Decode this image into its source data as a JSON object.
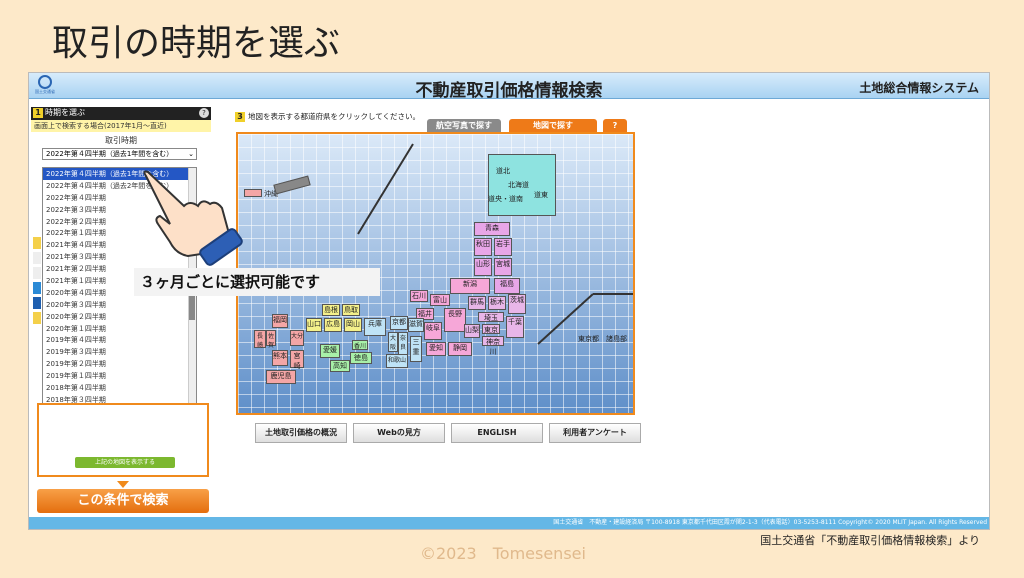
{
  "slide": {
    "title": "取引の時期を選ぶ",
    "credit": "©2023　Tomesensei",
    "source": "国土交通省「不動産取引価格情報検索」より",
    "callout": "３ヶ月ごとに選択可能です"
  },
  "app": {
    "logo_text": "国土交通省",
    "title": "不動産取引価格情報検索",
    "system_name": "土地総合情報システム",
    "footer": "国土交通省　不動産・建設経済局 〒100-8918 東京都千代田区霞が関2-1-3（代表電話）03-5253-8111 Copyright© 2020 MLIT Japan. All Rights Reserved"
  },
  "left_panel": {
    "step1_num": "1",
    "step1_title": "時期を選ぶ",
    "step1_info": "?",
    "subbar_text": "画面上で検索する場合(2017年1月～直近)",
    "period_label": "取引時期",
    "selected_value": "2022年第４四半期（過去1年間を含む）",
    "dropdown_options": [
      "2022年第４四半期（過去1年間を含む）",
      "2022年第４四半期（過去2年間を含む）",
      "2022年第４四半期",
      "2022年第３四半期",
      "2022年第２四半期",
      "2022年第１四半期",
      "2021年第４四半期",
      "2021年第３四半期",
      "2021年第２四半期",
      "2021年第１四半期",
      "2020年第４四半期",
      "2020年第３四半期",
      "2020年第２四半期",
      "2020年第１四半期",
      "2019年第４四半期",
      "2019年第３四半期",
      "2019年第２四半期",
      "2019年第１四半期",
      "2018年第４四半期",
      "2018年第３四半期"
    ],
    "show_map_button": "上記の地図を表示する",
    "search_button": "この条件で検索"
  },
  "map": {
    "step3_num": "3",
    "instruction": "地図を表示する都道府県をクリックしてください。",
    "tabs": {
      "aerial": "航空写真で探す",
      "map": "地図で探す",
      "help": "?"
    },
    "labels": {
      "okinawa": "沖縄",
      "dohoku": "道北",
      "hokkaido": "北海道",
      "doto": "道東",
      "doo_donan": "道央・道南",
      "aomori": "青森",
      "akita": "秋田",
      "iwate": "岩手",
      "yamagata": "山形",
      "miyagi": "宮城",
      "niigata": "新潟",
      "fukushima": "福島",
      "ishikawa": "石川",
      "toyama": "富山",
      "fukui": "福井",
      "nagano": "長野",
      "gunma": "群馬",
      "tochigi": "栃木",
      "ibaraki": "茨城",
      "saitama": "埼玉",
      "yamanashi": "山梨",
      "tokyo": "東京",
      "chiba": "千葉",
      "kanagawa": "神奈川",
      "gifu": "岐阜",
      "shizuoka": "静岡",
      "aichi": "愛知",
      "mie": "三重",
      "shiga": "滋賀",
      "kyoto": "京都",
      "osaka": "大阪",
      "nara": "奈良",
      "wakayama": "和歌山",
      "hyogo": "兵庫",
      "tottori": "鳥取",
      "shimane": "島根",
      "okayama": "岡山",
      "hiroshima": "広島",
      "yamaguchi": "山口",
      "kagawa": "香川",
      "tokushima": "徳島",
      "ehime": "愛媛",
      "kochi": "高知",
      "fukuoka": "福岡",
      "saga": "佐賀",
      "nagasaki": "長崎",
      "kumamoto": "熊本",
      "oita": "大分",
      "miyazaki": "宮崎",
      "kagoshima": "鹿児島",
      "tokyo_islands": "東京都　諸島部"
    },
    "links": [
      "土地取引価格の概況",
      "Webの見方",
      "ENGLISH",
      "利用者アンケート"
    ]
  },
  "colors": {
    "accent_orange": "#ee7a18",
    "selected_blue": "#2457c5",
    "hokkaido_tohoku": "#8ee3e0",
    "kanto": "#e8b6e8",
    "chubu": "#f6a7d8",
    "kinki": "#bfe3f6",
    "chugoku": "#f4f08a",
    "shikoku": "#a8f0a8",
    "kyushu": "#f4a6a6",
    "tohoku": "#e8a6e8"
  }
}
